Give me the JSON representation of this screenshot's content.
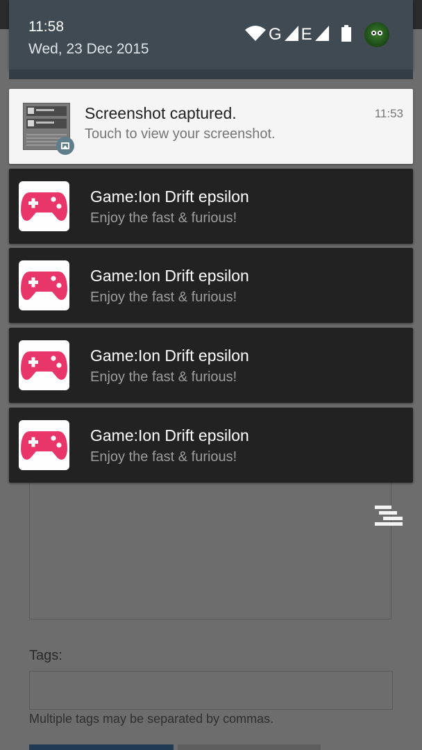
{
  "status_bar": {
    "time": "11:58",
    "date": "Wed, 23 Dec 2015",
    "icons": [
      "wifi-icon",
      "signal-icon",
      "battery-icon",
      "avatar"
    ],
    "network_letters": [
      "G",
      "E"
    ]
  },
  "notifications": {
    "screenshot": {
      "title": "Screenshot captured.",
      "text": "Touch to view your screenshot.",
      "time": "11:53",
      "icon": "image-icon"
    },
    "games": [
      {
        "title": "Game:Ion Drift epsilon",
        "text": "Enjoy the fast & furious!",
        "icon": "gamepad-icon"
      },
      {
        "title": "Game:Ion Drift epsilon",
        "text": "Enjoy the fast & furious!",
        "icon": "gamepad-icon"
      },
      {
        "title": "Game:Ion Drift epsilon",
        "text": "Enjoy the fast & furious!",
        "icon": "gamepad-icon"
      },
      {
        "title": "Game:Ion Drift epsilon",
        "text": "Enjoy the fast & furious!",
        "icon": "gamepad-icon"
      }
    ]
  },
  "background_form": {
    "tags_label": "Tags:",
    "tags_hint": "Multiple tags may be separated by commas."
  },
  "colors": {
    "shade_header": "#3f4a53",
    "game_notification_bg": "#222222",
    "gamepad_pink": "#e8366b",
    "screenshot_notification_bg": "#f5f5f5"
  }
}
